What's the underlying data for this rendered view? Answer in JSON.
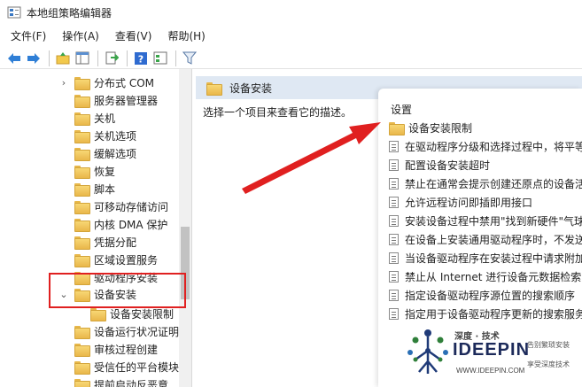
{
  "window": {
    "title": "本地组策略编辑器"
  },
  "menu": [
    "文件(F)",
    "操作(A)",
    "查看(V)",
    "帮助(H)"
  ],
  "toolbar": {
    "icons": [
      "back-arrow-icon",
      "forward-arrow-icon",
      "up-folder-icon",
      "show-hide-tree-icon",
      "export-list-icon",
      "help-icon",
      "properties-icon",
      "filter-icon"
    ]
  },
  "tree": {
    "items": [
      {
        "label": "分布式 COM",
        "expanded": false
      },
      {
        "label": "服务器管理器"
      },
      {
        "label": "关机"
      },
      {
        "label": "关机选项"
      },
      {
        "label": "缓解选项"
      },
      {
        "label": "恢复"
      },
      {
        "label": "脚本"
      },
      {
        "label": "可移动存储访问"
      },
      {
        "label": "内核 DMA 保护"
      },
      {
        "label": "凭据分配"
      },
      {
        "label": "区域设置服务"
      },
      {
        "label": "驱动程序安装"
      },
      {
        "label": "设备安装",
        "expanded": true,
        "selected": true
      },
      {
        "label": "设备安装限制",
        "child": true
      },
      {
        "label": "设备运行状况证明"
      },
      {
        "label": "审核过程创建"
      },
      {
        "label": "受信任的平台模块"
      },
      {
        "label": "提前启动反恶意"
      }
    ]
  },
  "right_pane": {
    "header_title": "设备安装",
    "description": "选择一个项目来查看它的描述。"
  },
  "settings": {
    "column_header": "设置",
    "folder": "设备安装限制",
    "items": [
      "在驱动程序分级和选择过程中，将平等",
      "配置设备安装超时",
      "禁止在通常会提示创建还原点的设备活",
      "允许远程访问即插即用接口",
      "安装设备过程中禁用\"找到新硬件\"气球",
      "在设备上安装通用驱动程序时，不发送",
      "当设备驱动程序在安装过程中请求附加",
      "禁止从 Internet 进行设备元数据检索",
      "指定设备驱动程序源位置的搜索顺序",
      "指定用于设备驱动程序更新的搜索服务"
    ]
  },
  "watermark": {
    "brand_cn": "深度 · 技术",
    "brand": "IDEEPIN",
    "url": "WWW.IDEEPIN.COM",
    "slogan1": "告别繁琐安装",
    "slogan2": "享受深度技术"
  },
  "colors": {
    "highlight_box": "#e02020",
    "arrow": "#e02020",
    "header_bg": "#dfe8f3"
  }
}
